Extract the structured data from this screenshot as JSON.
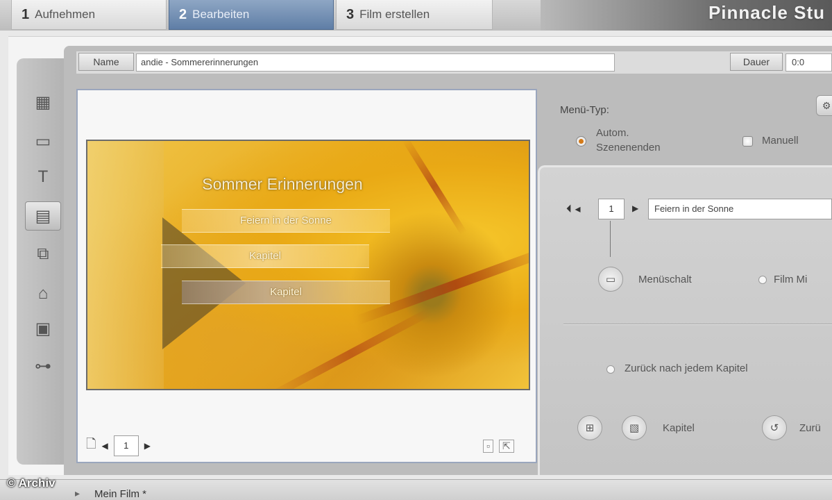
{
  "tabs": [
    {
      "num": "1",
      "label": "Aufnehmen",
      "active": false
    },
    {
      "num": "2",
      "label": "Bearbeiten",
      "active": true
    },
    {
      "num": "3",
      "label": "Film erstellen",
      "active": false
    }
  ],
  "brand": "Pinnacle Stu",
  "name_field": {
    "label": "Name",
    "value": "andie - Sommererinnerungen"
  },
  "dauer_field": {
    "label": "Dauer",
    "value": "0:0"
  },
  "tools": [
    {
      "icon": "timeline-icon"
    },
    {
      "icon": "video-clip-icon"
    },
    {
      "icon": "title-text-icon"
    },
    {
      "icon": "menu-icon",
      "active": true
    },
    {
      "icon": "transition-icon"
    },
    {
      "icon": "effects-icon"
    },
    {
      "icon": "frame-icon"
    },
    {
      "icon": "audio-icon"
    }
  ],
  "preview": {
    "menu_title": "Sommer Erinnerungen",
    "menu_buttons": [
      "Feiern in der Sonne",
      "Kapitel",
      "Kapitel"
    ],
    "page_number": "1"
  },
  "menu_type": {
    "label": "Menü-Typ:",
    "auto_label_line1": "Autom.",
    "auto_label_line2": "Szenenenden",
    "manual_label": "Manuell"
  },
  "link": {
    "number": "1",
    "value": "Feiern in der Sonne",
    "menu_label": "Menüschalt",
    "film_label": "Film Mi",
    "return_label": "Zurück nach jedem Kapitel",
    "chapter_label": "Kapitel",
    "zurueck_label": "Zurü"
  },
  "footer": {
    "film_label": "Mein Film *",
    "credit": "© Archiv"
  },
  "colors": {
    "active_tab": "#5f7ea6",
    "menu_gold": "#e8a91b",
    "radio_on": "#d47a18"
  }
}
